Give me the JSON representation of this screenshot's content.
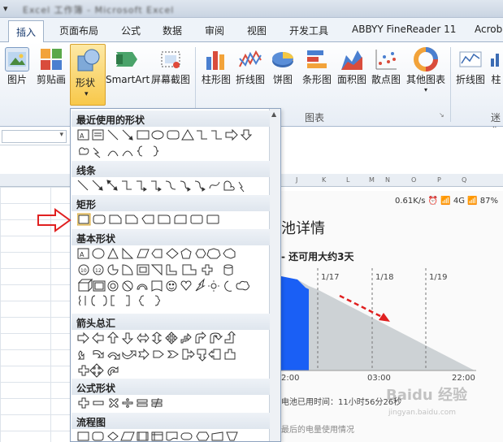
{
  "window": {
    "title": "Excel 工作簿 - Microsoft Excel",
    "qat_icon": "dropdown-caret"
  },
  "tabs": [
    {
      "label": "插入",
      "active": true
    },
    {
      "label": "页面布局"
    },
    {
      "label": "公式"
    },
    {
      "label": "数据"
    },
    {
      "label": "审阅"
    },
    {
      "label": "视图"
    },
    {
      "label": "开发工具"
    },
    {
      "label": "ABBYY FineReader 11"
    },
    {
      "label": "Acrob"
    }
  ],
  "ribbon": {
    "buttons": [
      {
        "label": "图片",
        "icon": "picture-icon"
      },
      {
        "label": "剪贴画",
        "icon": "clipart-icon"
      },
      {
        "label": "形状",
        "icon": "shapes-icon"
      },
      {
        "label": "SmartArt",
        "icon": "smartart-icon"
      },
      {
        "label": "屏幕截图",
        "icon": "screenshot-icon"
      },
      {
        "label": "柱形图",
        "icon": "column-chart-icon"
      },
      {
        "label": "折线图",
        "icon": "line-chart-icon"
      },
      {
        "label": "饼图",
        "icon": "pie-chart-icon"
      },
      {
        "label": "条形图",
        "icon": "bar-chart-icon"
      },
      {
        "label": "面积图",
        "icon": "area-chart-icon"
      },
      {
        "label": "散点图",
        "icon": "scatter-chart-icon"
      },
      {
        "label": "其他图表",
        "icon": "other-chart-icon"
      },
      {
        "label": "折线图",
        "icon": "sparkline-line-icon"
      },
      {
        "label": "柱",
        "icon": "sparkline-column-icon"
      }
    ],
    "group_charts": "图表",
    "group_sparklines": "迷你"
  },
  "dropdown": {
    "sections": [
      "最近使用的形状",
      "线条",
      "矩形",
      "基本形状",
      "箭头总汇",
      "公式形状",
      "流程图"
    ]
  },
  "phone": {
    "status": "0.61K/s ⏰ 📶 4G 📶 87%",
    "title": "池详情",
    "subtitle": "- 还可用大约3天",
    "dates": [
      "1/17",
      "1/18",
      "1/19"
    ],
    "times": [
      "2:00",
      "03:00",
      "22:00"
    ],
    "usage": "电池已用时间：11小时56分26秒",
    "footer": "最后的电量使用情况"
  },
  "columns": [
    "J",
    "K",
    "L",
    "M",
    "N",
    "O",
    "P",
    "Q"
  ],
  "colors": {
    "accent": "#f8c84a",
    "tab_text": "#1a3c70",
    "red": "#e02020",
    "battery_blue": "#1a5ff5"
  }
}
